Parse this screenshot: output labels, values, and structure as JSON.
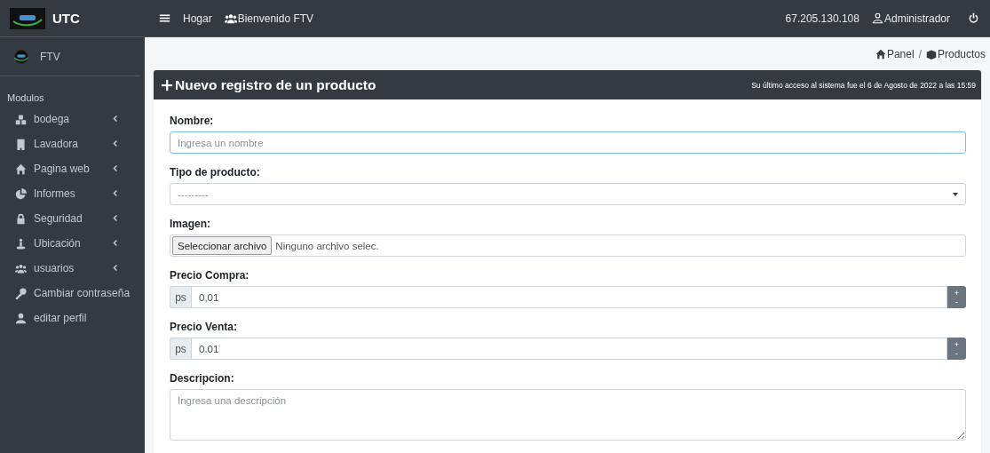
{
  "brand": {
    "title": "UTC"
  },
  "user_panel": {
    "name": "FTV"
  },
  "sidebar": {
    "header": "Modulos",
    "items": [
      {
        "label": "bodega",
        "kind": "submenu"
      },
      {
        "label": "Lavadora",
        "kind": "submenu"
      },
      {
        "label": "Pagina web",
        "kind": "submenu"
      },
      {
        "label": "Informes",
        "kind": "submenu"
      },
      {
        "label": "Seguridad",
        "kind": "submenu"
      },
      {
        "label": "Ubicación",
        "kind": "submenu"
      },
      {
        "label": "usuarios",
        "kind": "submenu"
      },
      {
        "label": "Cambiar contraseña",
        "kind": "link"
      },
      {
        "label": "editar perfil",
        "kind": "link"
      }
    ]
  },
  "topbar": {
    "home_link": "Hogar",
    "welcome": "Bienvenido FTV",
    "ip": "67.205.130.108",
    "user": "Administrador"
  },
  "breadcrumb": [
    {
      "label": "Panel"
    },
    {
      "label": "Productos"
    }
  ],
  "breadcrumb_separator": "/",
  "card": {
    "title": "Nuevo registro de un producto",
    "last_access": "Su último acceso al sistema fue el 6 de Agosto de 2022 a las 15:59"
  },
  "form_fields": [
    {
      "label": "Nombre:",
      "kind": "text",
      "placeholder": "Ingresa un nombre",
      "focused": true
    },
    {
      "label": "Tipo de producto:",
      "kind": "select",
      "placeholder": "---------",
      "focused": false
    },
    {
      "label": "Imagen:",
      "kind": "file",
      "button": "Seleccionar archivo",
      "status": "Ninguno archivo selec.",
      "focused": false
    },
    {
      "label": "Precio Compra:",
      "kind": "number",
      "prefix": "ps",
      "value": "0,01",
      "increment": "+",
      "decrement": "-",
      "focused": false
    },
    {
      "label": "Precio Venta:",
      "kind": "number",
      "prefix": "ps",
      "value": "0.01",
      "increment": "+",
      "decrement": "-",
      "focused": false
    },
    {
      "label": "Descripcion:",
      "kind": "textarea",
      "placeholder": "Ingresa una descripción",
      "focused": false
    }
  ]
}
